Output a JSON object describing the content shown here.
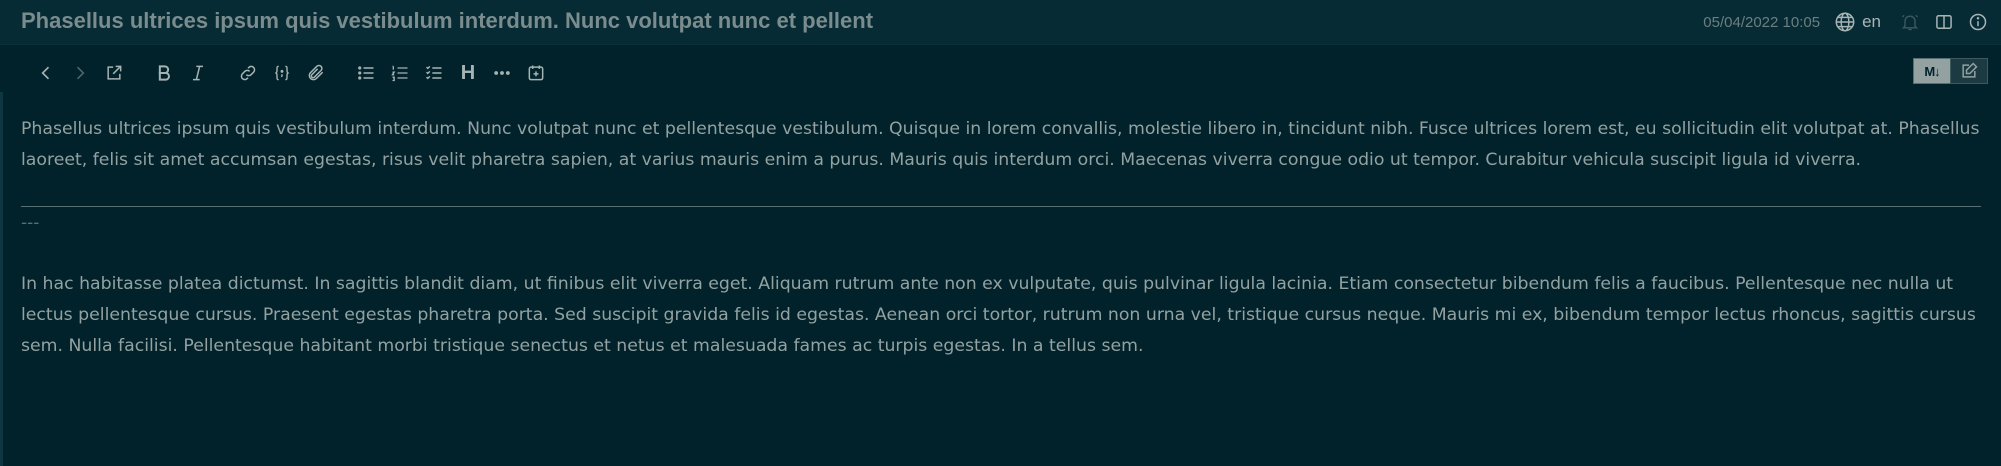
{
  "header": {
    "title": "Phasellus ultrices ipsum quis vestibulum interdum. Nunc volutpat nunc et pellent",
    "timestamp": "05/04/2022 10:05",
    "language": "en",
    "icons": [
      "globe-icon",
      "bell-icon",
      "split-view-icon",
      "info-icon"
    ]
  },
  "toolbar": {
    "heading_label": "H",
    "items": [
      "back-icon",
      "forward-icon",
      "open-external-icon",
      "bold-icon",
      "italic-icon",
      "link-icon",
      "code-icon",
      "attachment-icon",
      "bullet-list-icon",
      "numbered-list-icon",
      "checklist-icon",
      "heading-icon",
      "more-icon",
      "insert-date-icon"
    ],
    "mode_markdown_label": "M↓",
    "mode_edit_icon": "edit-icon"
  },
  "document": {
    "paragraph1": "Phasellus ultrices ipsum quis vestibulum interdum. Nunc volutpat nunc et pellentesque vestibulum. Quisque in lorem convallis, molestie libero in, tincidunt nibh. Fusce ultrices lorem est, eu sollicitudin elit volutpat at. Phasellus laoreet, felis sit amet accumsan egestas, risus velit pharetra sapien, at varius mauris enim a purus. Mauris quis interdum orci. Maecenas viverra congue odio ut tempor. Curabitur vehicula suscipit ligula id viverra.",
    "separator_text": "---",
    "paragraph2": "In hac habitasse platea dictumst. In sagittis blandit diam, ut finibus elit viverra eget. Aliquam rutrum ante non ex vulputate, quis pulvinar ligula lacinia. Etiam consectetur bibendum felis a faucibus. Pellentesque nec nulla ut lectus pellentesque cursus. Praesent egestas pharetra porta. Sed suscipit gravida felis id egestas. Aenean orci tortor, rutrum non urna vel, tristique cursus neque. Mauris mi ex, bibendum tempor lectus rhoncus, sagittis cursus sem. Nulla facilisi. Pellentesque habitant morbi tristique senectus et netus et malesuada fames ac turpis egestas. In a tellus sem."
  },
  "colors": {
    "background": "#01222b",
    "header_background": "#072b34",
    "text": "#93a1a1",
    "muted": "#586e75"
  }
}
